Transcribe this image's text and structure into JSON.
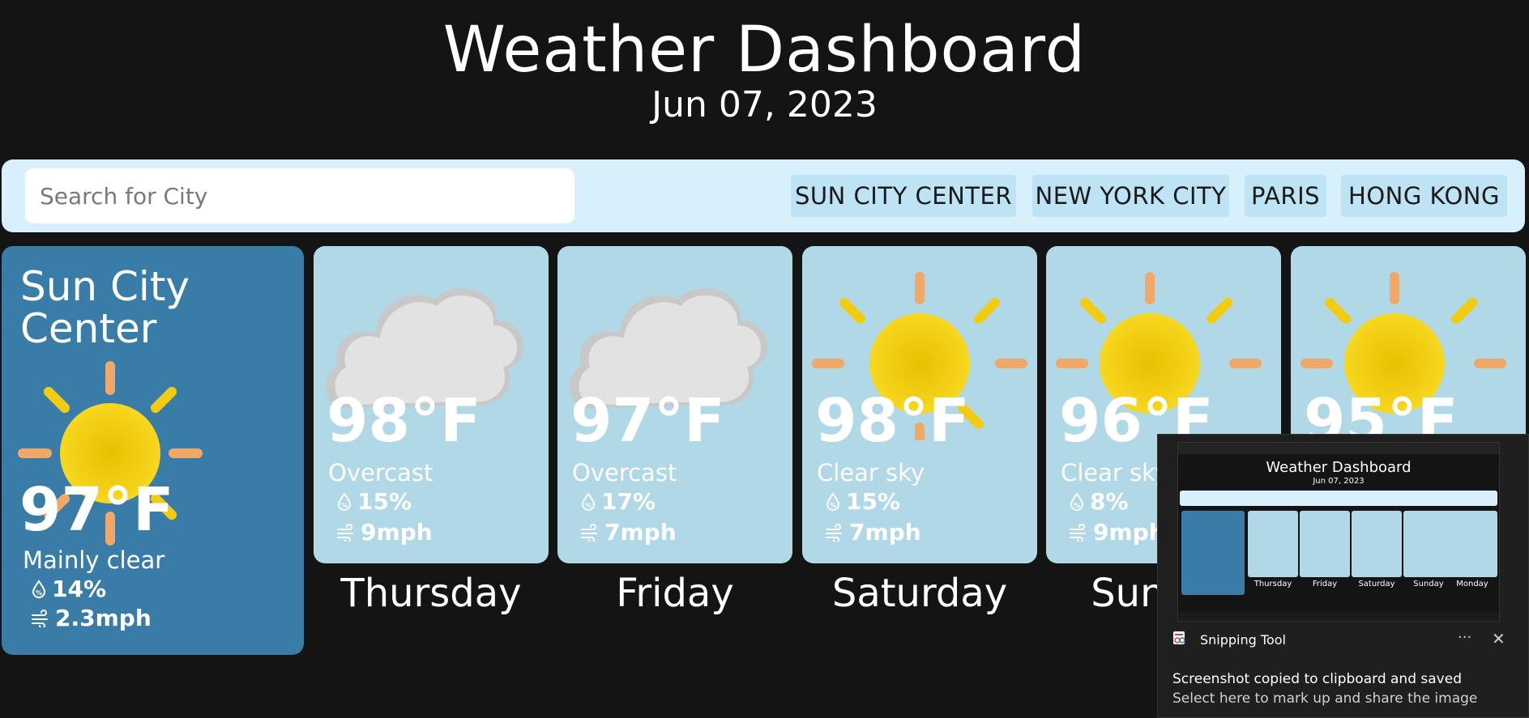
{
  "header": {
    "title": "Weather Dashboard",
    "date": "Jun 07, 2023"
  },
  "search": {
    "placeholder": "Search for City",
    "value": ""
  },
  "cities": [
    "SUN CITY CENTER",
    "NEW YORK CITY",
    "PARIS",
    "HONG KONG"
  ],
  "current": {
    "city": "Sun City Center",
    "icon": "sun-icon",
    "temp": "97°F",
    "description": "Mainly clear",
    "humidity": "14%",
    "wind": "2.3mph"
  },
  "forecast": [
    {
      "day": "Thursday",
      "icon": "cloud-icon",
      "temp": "98°F",
      "description": "Overcast",
      "humidity": "15%",
      "wind": "9mph"
    },
    {
      "day": "Friday",
      "icon": "cloud-icon",
      "temp": "97°F",
      "description": "Overcast",
      "humidity": "17%",
      "wind": "7mph"
    },
    {
      "day": "Saturday",
      "icon": "sun-icon",
      "temp": "98°F",
      "description": "Clear sky",
      "humidity": "15%",
      "wind": "7mph"
    },
    {
      "day": "Sunday",
      "icon": "sun-icon",
      "temp": "96°F",
      "description": "Clear sky",
      "humidity": "8%",
      "wind": "9mph"
    },
    {
      "day": "Monday",
      "icon": "sun-icon",
      "temp": "95°F",
      "description": "",
      "humidity": "",
      "wind": ""
    }
  ],
  "toast": {
    "app": "Snipping Tool",
    "more": "···",
    "close": "✕",
    "message": "Screenshot copied to clipboard and saved",
    "sub": "Select here to mark up and share the image",
    "thumbnail": {
      "title": "Weather Dashboard",
      "date": "Jun 07, 2023",
      "days": [
        "Thursday",
        "Friday",
        "Saturday",
        "Sunday",
        "Monday"
      ]
    }
  },
  "colors": {
    "background": "#141414",
    "search_bar": "#d8f0fb",
    "city_button": "#bde3f4",
    "current_card": "#3a7ca8",
    "forecast_card": "#b0d8e6",
    "sun": "#f2cc12",
    "sun_rays": "#f0a868",
    "cloud": "#e2e2e2"
  }
}
